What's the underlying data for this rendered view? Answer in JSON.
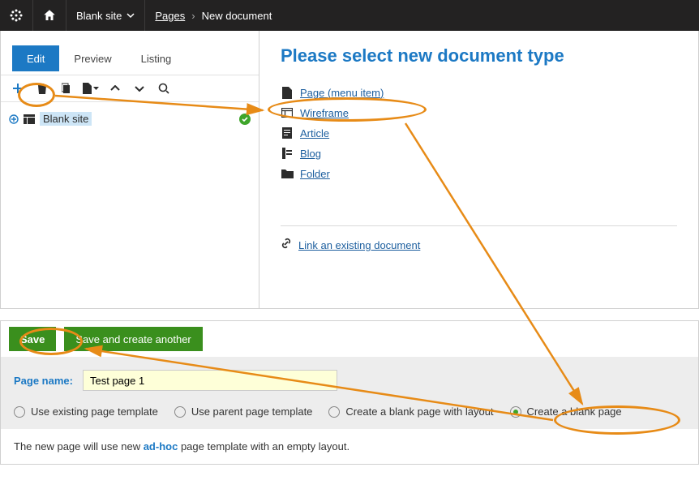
{
  "topbar": {
    "site": "Blank site",
    "crumb1": "Pages",
    "crumb2": "New document"
  },
  "tabs": {
    "edit": "Edit",
    "preview": "Preview",
    "listing": "Listing"
  },
  "tree": {
    "root": "Blank site"
  },
  "right": {
    "title": "Please select new document type",
    "types": {
      "page": "Page (menu item)",
      "wireframe": "Wireframe",
      "article": "Article",
      "blog": "Blog",
      "folder": "Folder"
    },
    "link_existing": "Link an existing document"
  },
  "lower": {
    "save": "Save",
    "save_another": "Save and create another",
    "page_name_label": "Page name:",
    "page_name_value": "Test page 1",
    "radios": {
      "existing": "Use existing page template",
      "parent": "Use parent page template",
      "blank_layout": "Create a blank page with layout",
      "blank": "Create a blank page"
    },
    "note_pre": "The new page will use new ",
    "note_bold": "ad-hoc",
    "note_post": " page template with an empty layout."
  }
}
